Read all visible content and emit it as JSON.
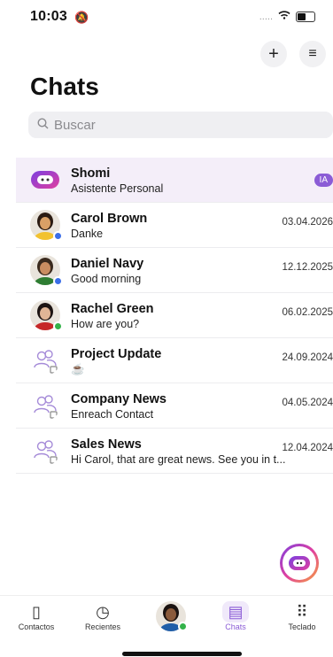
{
  "status": {
    "time": "10:03",
    "signal": "....."
  },
  "header": {
    "title": "Chats"
  },
  "search": {
    "placeholder": "Buscar"
  },
  "chats": [
    {
      "name": "Shomi",
      "subtitle": "Asistente Personal",
      "date": "",
      "badge": "IA",
      "kind": "assistant"
    },
    {
      "name": "Carol Brown",
      "subtitle": "Danke",
      "date": "03.04.2026",
      "kind": "person",
      "presence": "#3b6ee8",
      "skin": "#d9a066",
      "hair": "#2b1b12",
      "shirt": "#f2c230"
    },
    {
      "name": "Daniel Navy",
      "subtitle": "Good morning",
      "date": "12.12.2025",
      "kind": "person",
      "presence": "#3b6ee8",
      "skin": "#c98d61",
      "hair": "#3a2a1e",
      "shirt": "#2e7d32"
    },
    {
      "name": "Rachel Green",
      "subtitle": "How are you?",
      "date": "06.02.2025",
      "kind": "person",
      "presence": "#33b249",
      "skin": "#e0b596",
      "hair": "#1d1413",
      "shirt": "#c62828"
    },
    {
      "name": "Project Update",
      "subtitle": "☕",
      "date": "24.09.2024",
      "kind": "group"
    },
    {
      "name": "Company News",
      "subtitle": "Enreach Contact",
      "date": "04.05.2024",
      "kind": "group"
    },
    {
      "name": "Sales News",
      "subtitle": "Hi Carol, that are great news. See you in t...",
      "date": "12.04.2024",
      "kind": "group"
    }
  ],
  "tabs": [
    {
      "label": "Contactos",
      "icon": "contacts-icon",
      "glyph": "▯"
    },
    {
      "label": "Recientes",
      "icon": "recents-icon",
      "glyph": "◷"
    },
    {
      "label": "",
      "icon": "profile-avatar",
      "glyph": ""
    },
    {
      "label": "Chats",
      "icon": "chats-icon",
      "glyph": "▤"
    },
    {
      "label": "Teclado",
      "icon": "keypad-icon",
      "glyph": "⠿"
    }
  ],
  "colors": {
    "accent": "#8b5cd6",
    "highlight": "#f4eef9"
  }
}
